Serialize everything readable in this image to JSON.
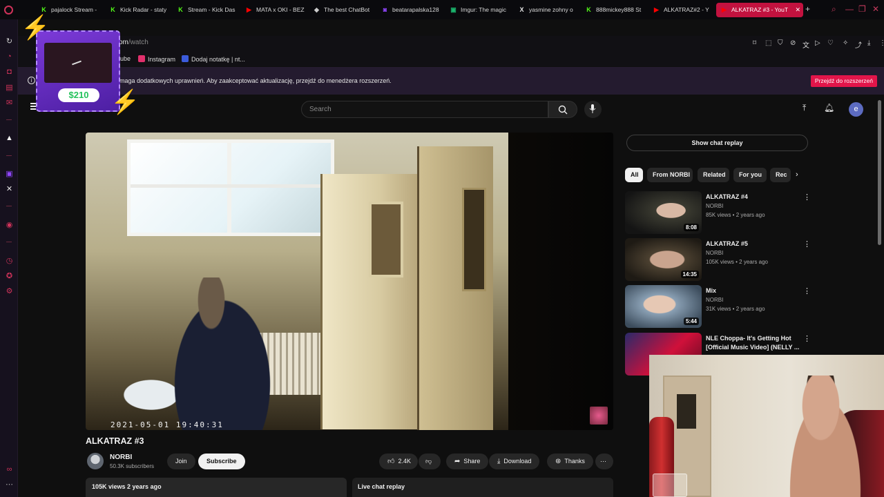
{
  "browser": {
    "tabs": [
      {
        "label": "pajalock Stream -",
        "fav": "K",
        "color": "#53fc18"
      },
      {
        "label": "Kick Radar - staty",
        "fav": "K",
        "color": "#53fc18"
      },
      {
        "label": "Stream - Kick Das",
        "fav": "K",
        "color": "#53fc18"
      },
      {
        "label": "MATA x OKI - BEZ",
        "fav": "▶",
        "color": "#ff0000"
      },
      {
        "label": "The best ChatBot",
        "fav": "◆",
        "color": "#cccccc"
      },
      {
        "label": "beatarapalska128",
        "fav": "◙",
        "color": "#9146ff"
      },
      {
        "label": "Imgur: The magic",
        "fav": "▣",
        "color": "#1bb76e"
      },
      {
        "label": "yasmine zohny o",
        "fav": "X",
        "color": "#e7e7e7"
      },
      {
        "label": "888mickey888 St",
        "fav": "K",
        "color": "#53fc18"
      },
      {
        "label": "ALKATRAZ#2 - Y",
        "fav": "▶",
        "color": "#ff0000"
      },
      {
        "label": "ALKATRAZ #3 - YouT",
        "fav": "▶",
        "color": "#ff0000"
      }
    ],
    "tab_add": "+",
    "url_host": "om",
    "url_path": "/watch",
    "bookmarks": [
      {
        "label": "ube",
        "color": "#ff0000"
      },
      {
        "label": "Instagram",
        "color": "#e1306c"
      },
      {
        "label": "Dodaj notatkę | nt...",
        "color": "#3b5bdb"
      }
    ],
    "notice_text": "maga dodatkowych uprawnień. Aby zaakceptować aktualizację, przejdź do menedżera rozszerzeń.",
    "notice_button": "Przejdź do rozszerzeń"
  },
  "overlay": {
    "money": "$210"
  },
  "youtube": {
    "search_placeholder": "Search",
    "avatar_letter": "e",
    "video": {
      "timestamp": "2021-05-01 19:40:31",
      "title": "ALKATRAZ #3",
      "channel": "NORBI",
      "subscribers": "50.3K subscribers",
      "join": "Join",
      "subscribe": "Subscribe",
      "likes": "2.4K",
      "share": "Share",
      "download": "Download",
      "thanks": "Thanks",
      "more": "⋯",
      "description_meta": "105K views  2 years ago",
      "live_chat": "Live chat replay"
    },
    "sidebar": {
      "show_chat": "Show chat replay",
      "chips": [
        "All",
        "From NORBI",
        "Related",
        "For you",
        "Rec"
      ],
      "recommendations": [
        {
          "title": "ALKATRAZ #4",
          "channel": "NORBI",
          "meta": "85K views • 2 years ago",
          "duration": "8:08"
        },
        {
          "title": "ALKATRAZ #5",
          "channel": "NORBI",
          "meta": "105K views • 2 years ago",
          "duration": "14:35"
        },
        {
          "title": "Mix",
          "channel": "NORBI",
          "meta": "31K views • 2 years ago",
          "duration": "5:44"
        },
        {
          "title": "NLE Choppa- It's Getting Hot [Official Music Video] (NELLY ...",
          "channel": "",
          "meta": "",
          "duration": ""
        }
      ]
    }
  }
}
